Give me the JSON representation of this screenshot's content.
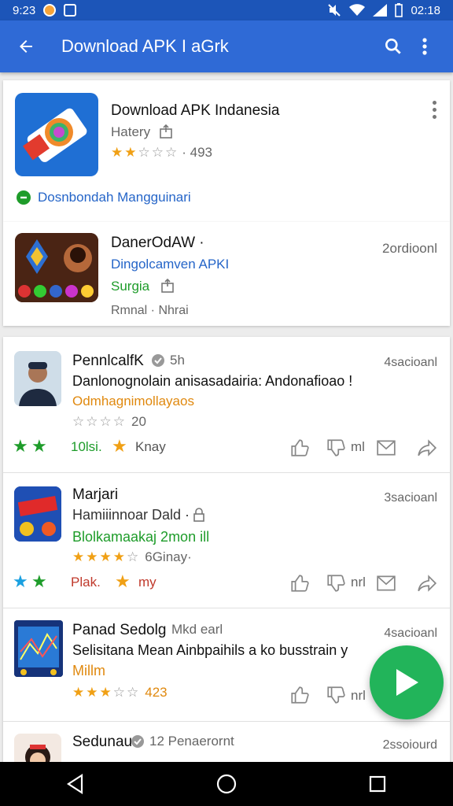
{
  "status": {
    "time_left": "9:23",
    "time_right": "02:18"
  },
  "appbar": {
    "title": "Download APK I aGrk"
  },
  "featured": {
    "name": "Download APK Indanesia",
    "category": "Hatery",
    "rating_count": "· 493",
    "stars": 2,
    "footer_link": "Dosnbondah Mangguinari"
  },
  "promo": {
    "name": "DanerOdAW ·",
    "line2": "Dingolcamven APKI",
    "line3": "Surgia",
    "line4": "Rmnal · Nhrai",
    "right": "2ordioonl"
  },
  "feed": [
    {
      "title": "PennlcalfK",
      "time": "5h",
      "headline": "Danlonognolain anisasadairia: Andonafioao !",
      "tag": "Odmhagnimollayaos",
      "rating_text": "20",
      "right": "4sacioanl",
      "stars": 0,
      "act_left": "10lsi.",
      "act_mid": "Knay",
      "act_short": "ml"
    },
    {
      "title": "Marjari",
      "time": "",
      "headline": "Hamiiinnoar Dald ·",
      "tag": "Blolkamaakaj 2mon ill",
      "rating_text": "6Ginay·",
      "right": "3sacioanl",
      "stars": 4,
      "act_left": "Plak.",
      "act_mid": "my",
      "act_short": "nrl"
    },
    {
      "title": "Panad Sedolg",
      "time": "Mkd earl",
      "headline": "Selisitana Mean Ainbpaihils a ko busstrain y",
      "tag": "Millm",
      "rating_text": "423",
      "right": "4sacioanl",
      "stars": 3,
      "act_left": "",
      "act_mid": "",
      "act_short": "nrl"
    },
    {
      "title": "Sedunau",
      "time": "12 Penaerornt",
      "headline": "",
      "tag": "",
      "rating_text": "",
      "right": "2ssoiourd",
      "stars": 0,
      "act_left": "",
      "act_mid": "",
      "act_short": ""
    }
  ],
  "colors": {
    "appbar": "#2f6ad6",
    "statusbar": "#1c55b8",
    "fab": "#22b45a",
    "accent_blue": "#2565c8",
    "green": "#1e9c2a",
    "star": "#f0a015"
  }
}
